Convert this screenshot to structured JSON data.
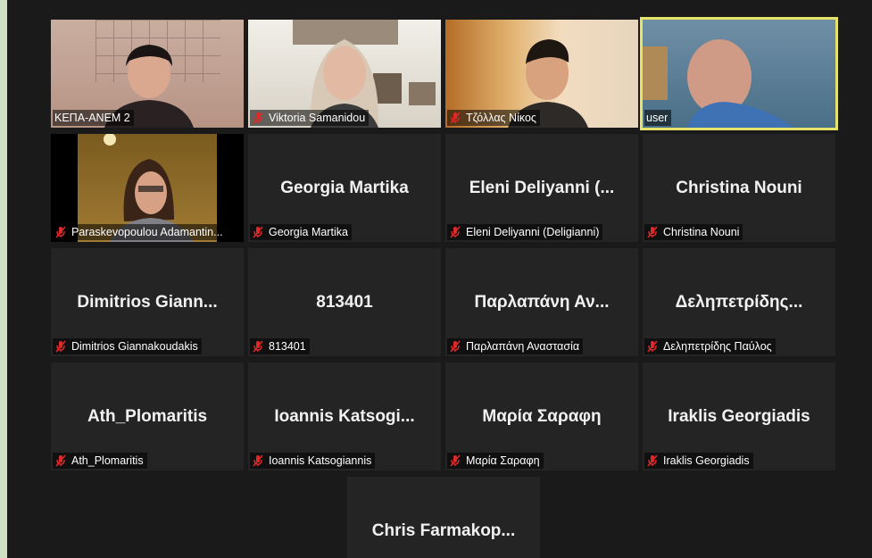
{
  "participants": [
    {
      "display": "",
      "label": "ΚΕΠΑ-ΑΝΕΜ 2",
      "video": true,
      "muted": false,
      "active": false
    },
    {
      "display": "",
      "label": "Viktoria Samanidou",
      "video": true,
      "muted": true,
      "active": false
    },
    {
      "display": "",
      "label": "Τζόλλας Νίκος",
      "video": true,
      "muted": true,
      "active": false
    },
    {
      "display": "",
      "label": "user",
      "video": true,
      "muted": false,
      "active": true
    },
    {
      "display": "",
      "label": "Paraskevopoulou Adamantin...",
      "video": true,
      "muted": true,
      "active": false
    },
    {
      "display": "Georgia Martika",
      "label": "Georgia Martika",
      "video": false,
      "muted": true,
      "active": false
    },
    {
      "display": "Eleni  Deliyanni  (...",
      "label": "Eleni Deliyanni (Deligianni)",
      "video": false,
      "muted": true,
      "active": false
    },
    {
      "display": "Christina Nouni",
      "label": "Christina Nouni",
      "video": false,
      "muted": true,
      "active": false
    },
    {
      "display": "Dimitrios  Giann...",
      "label": "Dimitrios Giannakoudakis",
      "video": false,
      "muted": true,
      "active": false
    },
    {
      "display": "813401",
      "label": "813401",
      "video": false,
      "muted": true,
      "active": false
    },
    {
      "display": "Παρλαπάνη Αν...",
      "label": "Παρλαπάνη Αναστασία",
      "video": false,
      "muted": true,
      "active": false
    },
    {
      "display": "Δεληπετρίδης...",
      "label": "Δεληπετρίδης Παύλος",
      "video": false,
      "muted": true,
      "active": false
    },
    {
      "display": "Ath_Plomaritis",
      "label": "Ath_Plomaritis",
      "video": false,
      "muted": true,
      "active": false
    },
    {
      "display": "Ioannis  Katsogi...",
      "label": "Ioannis Katsogiannis",
      "video": false,
      "muted": true,
      "active": false
    },
    {
      "display": "Μαρία Σαραφη",
      "label": "Μαρία Σαραφη",
      "video": false,
      "muted": true,
      "active": false
    },
    {
      "display": "Iraklis Georgiadis",
      "label": "Iraklis Georgiadis",
      "video": false,
      "muted": true,
      "active": false
    },
    {
      "display": "Chris  Farmakop...",
      "label": "",
      "video": false,
      "muted": false,
      "active": false
    }
  ],
  "icons": {
    "muted": "mic-muted-icon"
  },
  "colors": {
    "active_border": "#e6e36b",
    "mute_red": "#e02828"
  }
}
